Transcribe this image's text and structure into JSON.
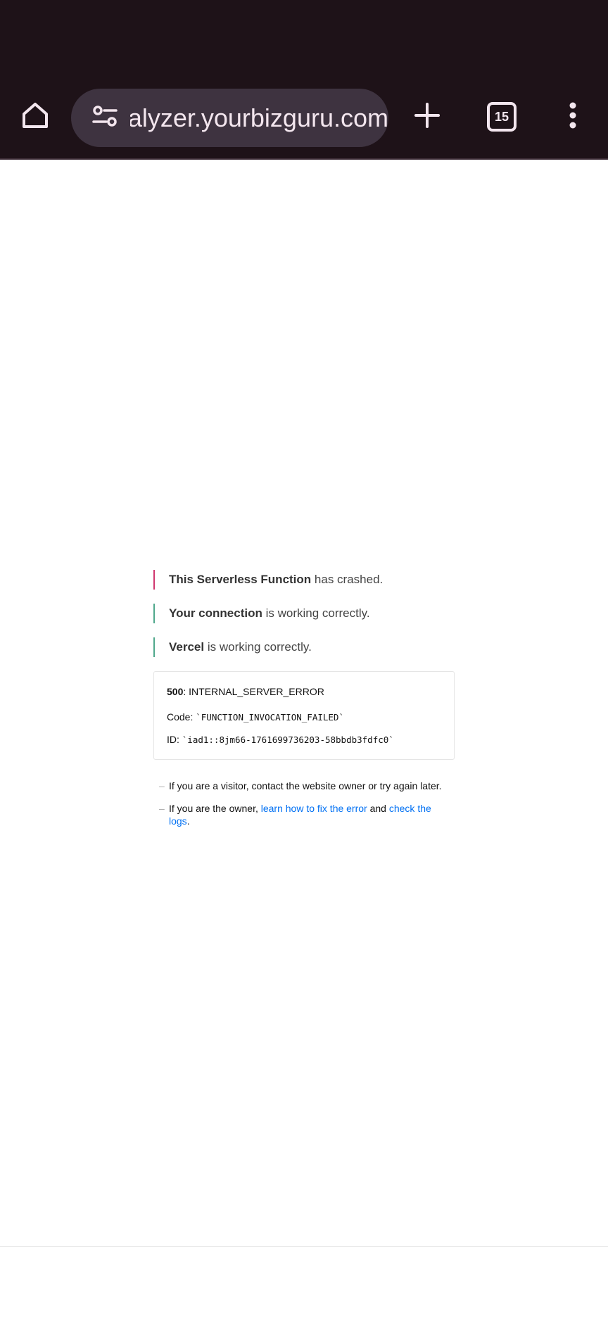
{
  "browser": {
    "url": "nalyzer.yourbizguru.com",
    "tab_count": "15",
    "icons": {
      "home": "home-icon",
      "site_info": "site-settings-icon",
      "new_tab": "plus-icon",
      "tabs": "tab-switcher-icon",
      "menu": "more-vert-icon"
    }
  },
  "status": [
    {
      "bold": "This Serverless Function",
      "rest": " has crashed.",
      "color": "#d0386f"
    },
    {
      "bold": "Your connection",
      "rest": " is working correctly.",
      "color": "#50a88c"
    },
    {
      "bold": "Vercel",
      "rest": " is working correctly.",
      "color": "#50a88c"
    }
  ],
  "error": {
    "code_number": "500",
    "code_name": ": INTERNAL_SERVER_ERROR",
    "code_label": "Code: ",
    "code_value": "`FUNCTION_INVOCATION_FAILED`",
    "id_label": "ID: ",
    "id_value": "`iad1::8jm66-1761699736203-58bbdb3fdfc0`"
  },
  "notes": {
    "visitor": "If you are a visitor, contact the website owner or try again later.",
    "owner_prefix": "If you are the owner, ",
    "fix_link": "learn how to fix the error",
    "and": " and ",
    "logs_link": "check the logs",
    "suffix": "."
  },
  "colors": {
    "toolbar_bg": "#1e1218",
    "pill_bg": "#3e3340",
    "link": "#0070f3"
  }
}
